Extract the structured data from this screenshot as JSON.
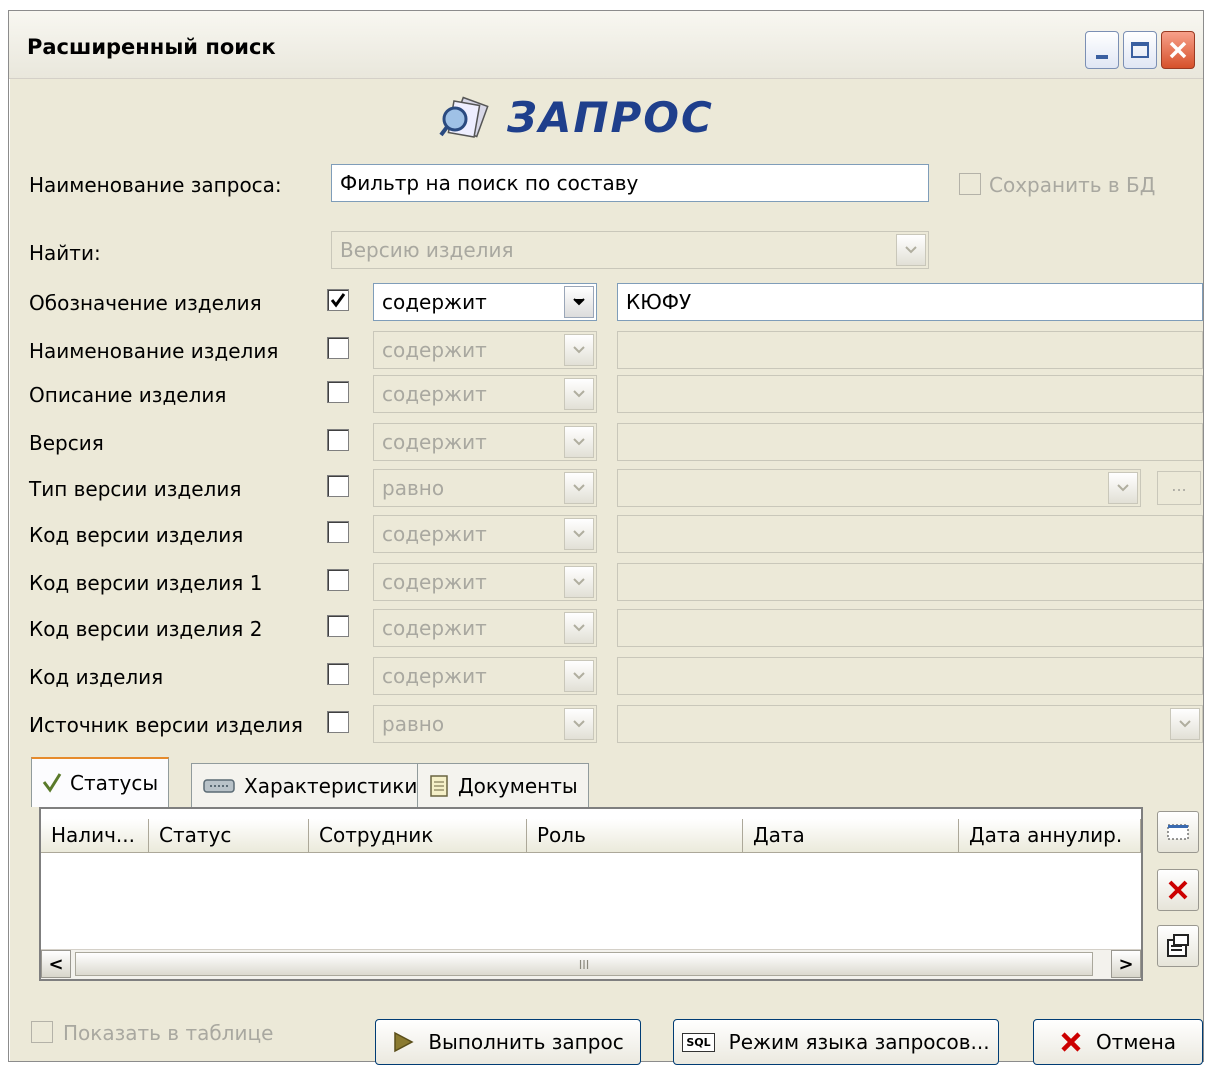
{
  "window": {
    "title": "Расширенный поиск",
    "controls": {
      "minimize_icon": "minimize-icon",
      "maximize_icon": "maximize-icon",
      "close_icon": "close-icon"
    }
  },
  "header": {
    "title": "ЗАПРОС",
    "icon": "query-icon",
    "color": "#1f3f8c"
  },
  "query_name": {
    "label": "Наименование запроса:",
    "value": "Фильтр на поиск по составу"
  },
  "save_db": {
    "label": "Сохранить в БД",
    "checked": false,
    "disabled": true
  },
  "find": {
    "label": "Найти:",
    "value": "Версию изделия",
    "disabled": true
  },
  "criteria": [
    {
      "label": "Обозначение изделия",
      "checked": true,
      "operator": "содержит",
      "value": "КЮФУ",
      "enabled": true
    },
    {
      "label": "Наименование изделия",
      "checked": false,
      "operator": "содержит",
      "value": "",
      "enabled": false
    },
    {
      "label": "Описание изделия",
      "checked": false,
      "operator": "содержит",
      "value": "",
      "enabled": false
    },
    {
      "label": "Версия",
      "checked": false,
      "operator": "содержит",
      "value": "",
      "enabled": false
    },
    {
      "label": "Тип версии изделия",
      "checked": false,
      "operator": "равно",
      "value": "",
      "enabled": false,
      "browse_label": "..."
    },
    {
      "label": "Код версии изделия",
      "checked": false,
      "operator": "содержит",
      "value": "",
      "enabled": false
    },
    {
      "label": "Код версии изделия 1",
      "checked": false,
      "operator": "содержит",
      "value": "",
      "enabled": false
    },
    {
      "label": "Код версии изделия 2",
      "checked": false,
      "operator": "содержит",
      "value": "",
      "enabled": false
    },
    {
      "label": "Код изделия",
      "checked": false,
      "operator": "содержит",
      "value": "",
      "enabled": false
    },
    {
      "label": "Источник версии изделия",
      "checked": false,
      "operator": "равно",
      "value": "",
      "enabled": false
    }
  ],
  "tabs": [
    {
      "label": "Статусы",
      "icon": "checkmark-icon",
      "active": true
    },
    {
      "label": "Характеристики",
      "icon": "tag-icon",
      "active": false
    },
    {
      "label": "Документы",
      "icon": "document-icon",
      "active": false
    }
  ],
  "grid": {
    "columns": [
      "Налич...",
      "Статус",
      "Сотрудник",
      "Роль",
      "Дата",
      "Дата аннулир."
    ],
    "rows": [],
    "scroll_left": "<",
    "scroll_right": ">",
    "scroll_grip": "III"
  },
  "side_buttons": [
    {
      "name": "add-row-button",
      "icon": "new-row-icon"
    },
    {
      "name": "delete-row-button",
      "icon": "delete-icon",
      "color": "#cc0000"
    },
    {
      "name": "properties-button",
      "icon": "properties-icon"
    }
  ],
  "footer": {
    "show_in_table": {
      "label": "Показать в таблице",
      "checked": false,
      "disabled": true
    },
    "execute_label": "Выполнить запрос",
    "query_language_label": "Режим языка запросов...",
    "query_language_icon_text": "SQL",
    "cancel_label": "Отмена"
  }
}
